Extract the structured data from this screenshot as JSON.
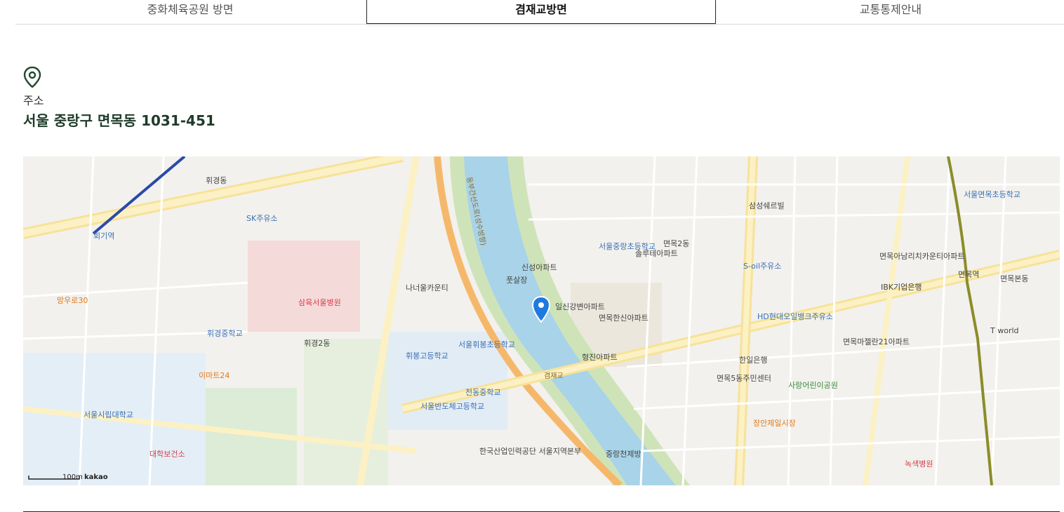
{
  "tabs": [
    {
      "label": "중화체육공원 방면"
    },
    {
      "label": "겸재교방면"
    },
    {
      "label": "교통통제안내"
    }
  ],
  "address": {
    "icon": "location-pin-icon",
    "label": "주소",
    "value": "서울 중랑구 면목동 1031-451"
  },
  "map": {
    "provider": "kakao",
    "scale_label": "100m",
    "labels": {
      "mangwoo": "망우로30",
      "hwigi": "회기역",
      "hwigidong": "휘경동",
      "samyuk": "삼육서울병원",
      "hwigyung2": "휘경2동",
      "natural": "나너울카운티",
      "hwibong_high": "휘봉고등학교",
      "seoul_hwibong": "서울휘봉초등학교",
      "jeonthong": "전동중학교",
      "seoul_bando": "서울반도체고등학교",
      "dongbu": "동부간선도로(성수방향)",
      "footsal": "풋살장",
      "ilsin": "일신강변아파트",
      "myeonmok_hansin": "면목한신아파트",
      "hyeongjin": "형진아파트",
      "gyeomjaegyo": "겸재교",
      "sinseong": "신성아파트",
      "myeonmok2": "면목2동",
      "myeonmok5": "면목5동주민센터",
      "sarang": "사랑어린이공원",
      "hanil": "한일은행",
      "hd": "HD현대오일뱅크주유소",
      "myeonmok_bon": "면목본동",
      "myeonmok_stn": "면목역",
      "seoul_myeonmok": "서울면목초등학교",
      "tworld": "T world",
      "jangan": "장안제일시장",
      "noksaek": "녹색병원",
      "hankuk": "한국산업인력공단 서울지역본부",
      "jungrang": "중랑천제방",
      "daehak": "대학보건소",
      "seoul_city": "서울시립대학교",
      "emart": "이마트24",
      "hwigyeong_mid": "휘경중학교",
      "sk": "SK주유소",
      "bokji": "서울중랑초등학교",
      "sol": "솔루테아파트",
      "samsung": "삼성쉐르빌",
      "sexpo": "S-oil주유소",
      "myeonmok_apt": "면목아남리치카운티아파트",
      "ibk": "IBK기업은행",
      "kids": "면목마젤란21아파트"
    }
  }
}
